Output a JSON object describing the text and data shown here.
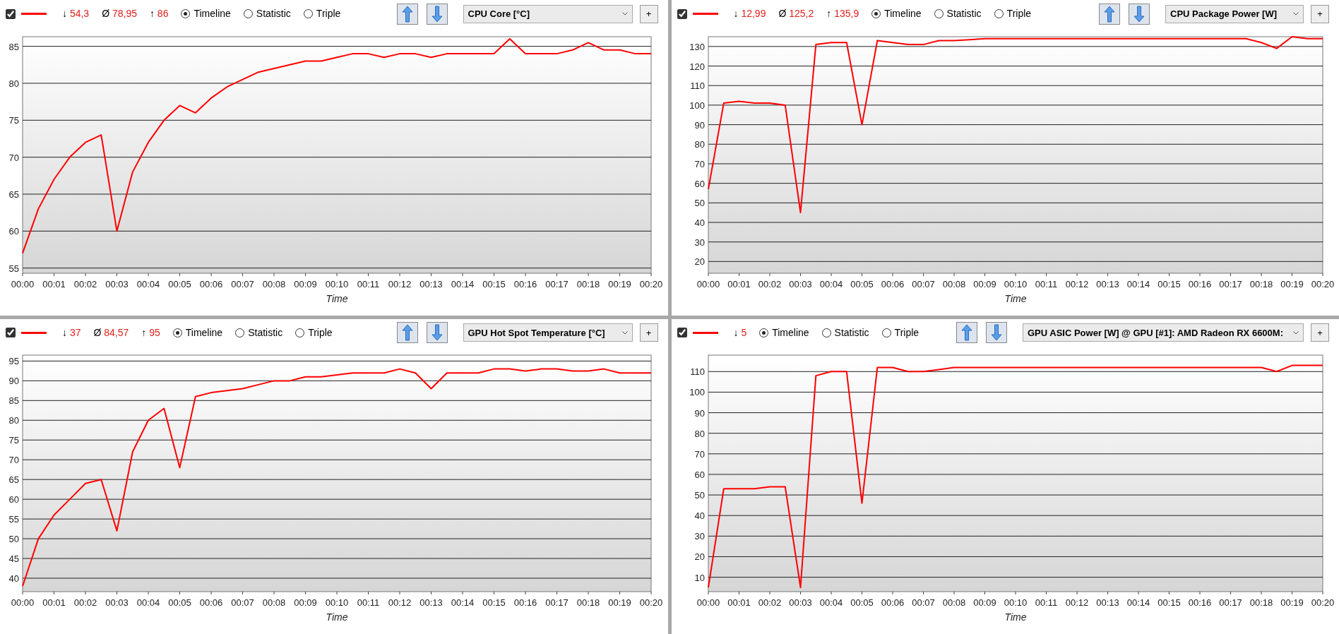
{
  "panels": [
    {
      "checked": true,
      "stats": [
        {
          "symbol": "↓",
          "value": "54,3"
        },
        {
          "symbol": "Ø",
          "value": "78,95"
        },
        {
          "symbol": "↑",
          "value": "86"
        }
      ],
      "view_options": [
        {
          "label": "Timeline",
          "selected": true
        },
        {
          "label": "Statistic",
          "selected": false
        },
        {
          "label": "Triple",
          "selected": false
        }
      ],
      "sensor": "CPU Core [°C]",
      "add_button": "+",
      "chart_data": {
        "type": "line",
        "xlabel": "Time",
        "xlim": [
          0,
          20
        ],
        "ylim": [
          54.3,
          86.3
        ],
        "x": [
          0,
          0.5,
          1,
          1.5,
          2,
          2.5,
          3,
          3.5,
          4,
          4.5,
          5,
          5.5,
          6,
          6.5,
          7,
          7.5,
          8,
          8.5,
          9,
          9.5,
          10,
          10.5,
          11,
          11.5,
          12,
          12.5,
          13,
          13.5,
          14,
          14.5,
          15,
          15.5,
          16,
          16.5,
          17,
          17.5,
          18,
          18.5,
          19,
          19.5,
          20
        ],
        "xticks": [
          {
            "value": 0,
            "label": "00:00"
          },
          {
            "value": 1,
            "label": "00:01"
          },
          {
            "value": 2,
            "label": "00:02"
          },
          {
            "value": 3,
            "label": "00:03"
          },
          {
            "value": 4,
            "label": "00:04"
          },
          {
            "value": 5,
            "label": "00:05"
          },
          {
            "value": 6,
            "label": "00:06"
          },
          {
            "value": 7,
            "label": "00:07"
          },
          {
            "value": 8,
            "label": "00:08"
          },
          {
            "value": 9,
            "label": "00:09"
          },
          {
            "value": 10,
            "label": "00:10"
          },
          {
            "value": 11,
            "label": "00:11"
          },
          {
            "value": 12,
            "label": "00:12"
          },
          {
            "value": 13,
            "label": "00:13"
          },
          {
            "value": 14,
            "label": "00:14"
          },
          {
            "value": 15,
            "label": "00:15"
          },
          {
            "value": 16,
            "label": "00:16"
          },
          {
            "value": 17,
            "label": "00:17"
          },
          {
            "value": 18,
            "label": "00:18"
          },
          {
            "value": 19,
            "label": "00:19"
          },
          {
            "value": 20,
            "label": "00:20"
          }
        ],
        "yticks": [
          55,
          60,
          65,
          70,
          75,
          80,
          85
        ],
        "grid": true,
        "series": [
          {
            "color": "#ff0000",
            "values": [
              57,
              63,
              67,
              70,
              72,
              73,
              60,
              68,
              72,
              75,
              77,
              76,
              78,
              79.5,
              80.5,
              81.5,
              82,
              82.5,
              83,
              83,
              83.5,
              84,
              84,
              83.5,
              84,
              84,
              83.5,
              84,
              84,
              84,
              84,
              86,
              84,
              84,
              84,
              84.5,
              85.5,
              84.5,
              84.5,
              84,
              84
            ]
          }
        ]
      }
    },
    {
      "checked": true,
      "stats": [
        {
          "symbol": "↓",
          "value": "12,99"
        },
        {
          "symbol": "Ø",
          "value": "125,2"
        },
        {
          "symbol": "↑",
          "value": "135,9"
        }
      ],
      "view_options": [
        {
          "label": "Timeline",
          "selected": true
        },
        {
          "label": "Statistic",
          "selected": false
        },
        {
          "label": "Triple",
          "selected": false
        }
      ],
      "sensor": "CPU Package Power [W]",
      "add_button": "+",
      "chart_data": {
        "type": "line",
        "xlabel": "Time",
        "xlim": [
          0,
          20
        ],
        "ylim": [
          14,
          135
        ],
        "x": [
          0,
          0.5,
          1,
          1.5,
          2,
          2.5,
          3,
          3.5,
          4,
          4.5,
          5,
          5.5,
          6,
          6.5,
          7,
          7.5,
          8,
          8.5,
          9,
          9.5,
          10,
          10.5,
          11,
          11.5,
          12,
          12.5,
          13,
          13.5,
          14,
          14.5,
          15,
          15.5,
          16,
          16.5,
          17,
          17.5,
          18,
          18.5,
          19,
          19.5,
          20
        ],
        "xticks": [
          {
            "value": 0,
            "label": "00:00"
          },
          {
            "value": 1,
            "label": "00:01"
          },
          {
            "value": 2,
            "label": "00:02"
          },
          {
            "value": 3,
            "label": "00:03"
          },
          {
            "value": 4,
            "label": "00:04"
          },
          {
            "value": 5,
            "label": "00:05"
          },
          {
            "value": 6,
            "label": "00:06"
          },
          {
            "value": 7,
            "label": "00:07"
          },
          {
            "value": 8,
            "label": "00:08"
          },
          {
            "value": 9,
            "label": "00:09"
          },
          {
            "value": 10,
            "label": "00:10"
          },
          {
            "value": 11,
            "label": "00:11"
          },
          {
            "value": 12,
            "label": "00:12"
          },
          {
            "value": 13,
            "label": "00:13"
          },
          {
            "value": 14,
            "label": "00:14"
          },
          {
            "value": 15,
            "label": "00:15"
          },
          {
            "value": 16,
            "label": "00:16"
          },
          {
            "value": 17,
            "label": "00:17"
          },
          {
            "value": 18,
            "label": "00:18"
          },
          {
            "value": 19,
            "label": "00:19"
          },
          {
            "value": 20,
            "label": "00:20"
          }
        ],
        "yticks": [
          20,
          30,
          40,
          50,
          60,
          70,
          80,
          90,
          100,
          110,
          120,
          130
        ],
        "grid": true,
        "series": [
          {
            "color": "#ff0000",
            "values": [
              57,
              101,
              102,
              101,
              101,
              100,
              45,
              131,
              132,
              132,
              90,
              133,
              132,
              131,
              131,
              133,
              133,
              133.5,
              134,
              134,
              134,
              134,
              134,
              134,
              134,
              134,
              134,
              134,
              134,
              134,
              134,
              134,
              134,
              134,
              134,
              134,
              132,
              129,
              135,
              134,
              134
            ]
          }
        ]
      }
    },
    {
      "checked": true,
      "stats": [
        {
          "symbol": "↓",
          "value": "37"
        },
        {
          "symbol": "Ø",
          "value": "84,57"
        },
        {
          "symbol": "↑",
          "value": "95"
        }
      ],
      "view_options": [
        {
          "label": "Timeline",
          "selected": true
        },
        {
          "label": "Statistic",
          "selected": false
        },
        {
          "label": "Triple",
          "selected": false
        }
      ],
      "sensor": "GPU Hot Spot Temperature [°C]",
      "add_button": "+",
      "chart_data": {
        "type": "line",
        "xlabel": "Time",
        "xlim": [
          0,
          20
        ],
        "ylim": [
          36.6,
          96.5
        ],
        "x": [
          0,
          0.5,
          1,
          1.5,
          2,
          2.5,
          3,
          3.5,
          4,
          4.5,
          5,
          5.5,
          6,
          6.5,
          7,
          7.5,
          8,
          8.5,
          9,
          9.5,
          10,
          10.5,
          11,
          11.5,
          12,
          12.5,
          13,
          13.5,
          14,
          14.5,
          15,
          15.5,
          16,
          16.5,
          17,
          17.5,
          18,
          18.5,
          19,
          19.5,
          20
        ],
        "xticks": [
          {
            "value": 0,
            "label": "00:00"
          },
          {
            "value": 1,
            "label": "00:01"
          },
          {
            "value": 2,
            "label": "00:02"
          },
          {
            "value": 3,
            "label": "00:03"
          },
          {
            "value": 4,
            "label": "00:04"
          },
          {
            "value": 5,
            "label": "00:05"
          },
          {
            "value": 6,
            "label": "00:06"
          },
          {
            "value": 7,
            "label": "00:07"
          },
          {
            "value": 8,
            "label": "00:08"
          },
          {
            "value": 9,
            "label": "00:09"
          },
          {
            "value": 10,
            "label": "00:10"
          },
          {
            "value": 11,
            "label": "00:11"
          },
          {
            "value": 12,
            "label": "00:12"
          },
          {
            "value": 13,
            "label": "00:13"
          },
          {
            "value": 14,
            "label": "00:14"
          },
          {
            "value": 15,
            "label": "00:15"
          },
          {
            "value": 16,
            "label": "00:16"
          },
          {
            "value": 17,
            "label": "00:17"
          },
          {
            "value": 18,
            "label": "00:18"
          },
          {
            "value": 19,
            "label": "00:19"
          },
          {
            "value": 20,
            "label": "00:20"
          }
        ],
        "yticks": [
          40,
          45,
          50,
          55,
          60,
          65,
          70,
          75,
          80,
          85,
          90,
          95
        ],
        "grid": true,
        "series": [
          {
            "color": "#ff0000",
            "values": [
              38,
              50,
              56,
              60,
              64,
              65,
              52,
              72,
              80,
              83,
              68,
              86,
              87,
              87.5,
              88,
              89,
              90,
              90,
              91,
              91,
              91.5,
              92,
              92,
              92,
              93,
              92,
              88,
              92,
              92,
              92,
              93,
              93,
              92.5,
              93,
              93,
              92.5,
              92.5,
              93,
              92,
              92,
              92
            ]
          }
        ]
      }
    },
    {
      "checked": true,
      "stats": [
        {
          "symbol": "↓",
          "value": "5"
        }
      ],
      "view_options": [
        {
          "label": "Timeline",
          "selected": true
        },
        {
          "label": "Statistic",
          "selected": false
        },
        {
          "label": "Triple",
          "selected": false
        }
      ],
      "sensor": "GPU ASIC Power [W] @ GPU [#1]: AMD Radeon RX 6600M:",
      "add_button": "+",
      "chart_data": {
        "type": "line",
        "xlabel": "Time",
        "xlim": [
          0,
          20
        ],
        "ylim": [
          3,
          118
        ],
        "x": [
          0,
          0.5,
          1,
          1.5,
          2,
          2.5,
          3,
          3.5,
          4,
          4.5,
          5,
          5.5,
          6,
          6.5,
          7,
          7.5,
          8,
          8.5,
          9,
          9.5,
          10,
          10.5,
          11,
          11.5,
          12,
          12.5,
          13,
          13.5,
          14,
          14.5,
          15,
          15.5,
          16,
          16.5,
          17,
          17.5,
          18,
          18.5,
          19,
          19.5,
          20
        ],
        "xticks": [
          {
            "value": 0,
            "label": "00:00"
          },
          {
            "value": 1,
            "label": "00:01"
          },
          {
            "value": 2,
            "label": "00:02"
          },
          {
            "value": 3,
            "label": "00:03"
          },
          {
            "value": 4,
            "label": "00:04"
          },
          {
            "value": 5,
            "label": "00:05"
          },
          {
            "value": 6,
            "label": "00:06"
          },
          {
            "value": 7,
            "label": "00:07"
          },
          {
            "value": 8,
            "label": "00:08"
          },
          {
            "value": 9,
            "label": "00:09"
          },
          {
            "value": 10,
            "label": "00:10"
          },
          {
            "value": 11,
            "label": "00:11"
          },
          {
            "value": 12,
            "label": "00:12"
          },
          {
            "value": 13,
            "label": "00:13"
          },
          {
            "value": 14,
            "label": "00:14"
          },
          {
            "value": 15,
            "label": "00:15"
          },
          {
            "value": 16,
            "label": "00:16"
          },
          {
            "value": 17,
            "label": "00:17"
          },
          {
            "value": 18,
            "label": "00:18"
          },
          {
            "value": 19,
            "label": "00:19"
          },
          {
            "value": 20,
            "label": "00:20"
          }
        ],
        "yticks": [
          10,
          20,
          30,
          40,
          50,
          60,
          70,
          80,
          90,
          100,
          110
        ],
        "grid": true,
        "series": [
          {
            "color": "#ff0000",
            "values": [
              5,
              53,
              53,
              53,
              54,
              54,
              5,
              108,
              110,
              110,
              46,
              112,
              112,
              110,
              110,
              111,
              112,
              112,
              112,
              112,
              112,
              112,
              112,
              112,
              112,
              112,
              112,
              112,
              112,
              112,
              112,
              112,
              112,
              112,
              112,
              112,
              112,
              110,
              113,
              113,
              113
            ]
          }
        ]
      }
    }
  ]
}
